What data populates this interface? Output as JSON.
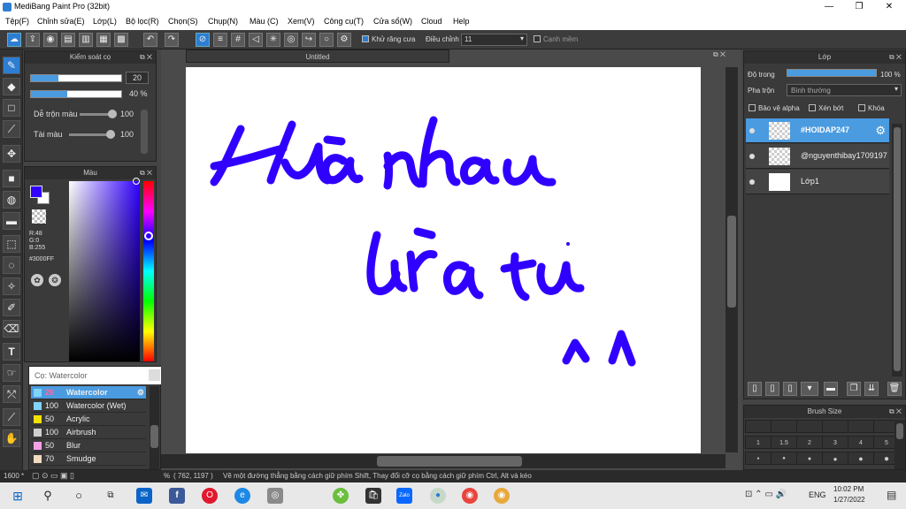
{
  "window": {
    "title": "MediBang Paint Pro (32bit)",
    "minimize": "—",
    "maximize": "❐",
    "close": "✕"
  },
  "menu": [
    "Tệp(F)",
    "Chỉnh sửa(E)",
    "Lớp(L)",
    "Bộ lọc(R)",
    "Chọn(S)",
    "Chụp(N)",
    "Màu (C)",
    "Xem(V)",
    "Công cụ(T)",
    "Cửa sổ(W)",
    "Cloud",
    "Help"
  ],
  "toolbar": {
    "antialias_label": "Khử răng cưa",
    "correction_label": "Điều chỉnh",
    "correction_value": "11",
    "edge_label": "Cạnh mềm"
  },
  "brush_control": {
    "title": "Kiểm soát cọ",
    "size_value": "20",
    "opacity_value": "40 %",
    "size_fill": 0.3,
    "opacity_fill": 0.4,
    "blend_label": "Dễ trộn màu",
    "blend_value": "100",
    "paint_label": "Tài màu",
    "paint_value": "100"
  },
  "color_panel": {
    "title": "Màu",
    "r": "R:48",
    "g": "G:0",
    "b": "B:255",
    "hex": "#3000FF",
    "primary": "#3000ff"
  },
  "brush_list": {
    "header": "Cọ: Watercolor",
    "items": [
      {
        "size": "20",
        "name": "Watercolor",
        "color": "#7fd4f7",
        "selected": true
      },
      {
        "size": "100",
        "name": "Watercolor (Wet)",
        "color": "#7fd4f7"
      },
      {
        "size": "50",
        "name": "Acrylic",
        "color": "#f5e100"
      },
      {
        "size": "100",
        "name": "Airbrush",
        "color": "#cfcfcf"
      },
      {
        "size": "50",
        "name": "Blur",
        "color": "#f5a0e6"
      },
      {
        "size": "70",
        "name": "Smudge",
        "color": "#f2dcc0"
      }
    ]
  },
  "document": {
    "tab_title": "Untitled"
  },
  "layer_panel": {
    "title": "Lớp",
    "opacity_label": "Độ trong",
    "opacity_value": "100 %",
    "blend_label": "Pha trộn",
    "blend_value": "Bình thường",
    "protect_alpha": "Bảo vệ alpha",
    "clipping": "Xén bớt",
    "lock": "Khóa",
    "layers": [
      {
        "name": "#HOIDAP247",
        "selected": true
      },
      {
        "name": "@nguyenthibay1709197"
      },
      {
        "name": "Lớp1"
      }
    ]
  },
  "brush_size": {
    "title": "Brush Size",
    "sizes": [
      "1",
      "1.5",
      "2",
      "3",
      "4",
      "5"
    ]
  },
  "status": {
    "zoom": "1600 *",
    "percent": "%",
    "coords": "( 762, 1197 )",
    "hint": "Vẽ một đường thẳng bằng cách giữ phím Shift, Thay đổi cỡ cọ bằng cách giữ phím Ctrl, Alt và kéo"
  },
  "taskbar": {
    "lang": "ENG",
    "time": "10:02 PM",
    "date": "1/27/2022",
    "zalo": "Zalo"
  }
}
